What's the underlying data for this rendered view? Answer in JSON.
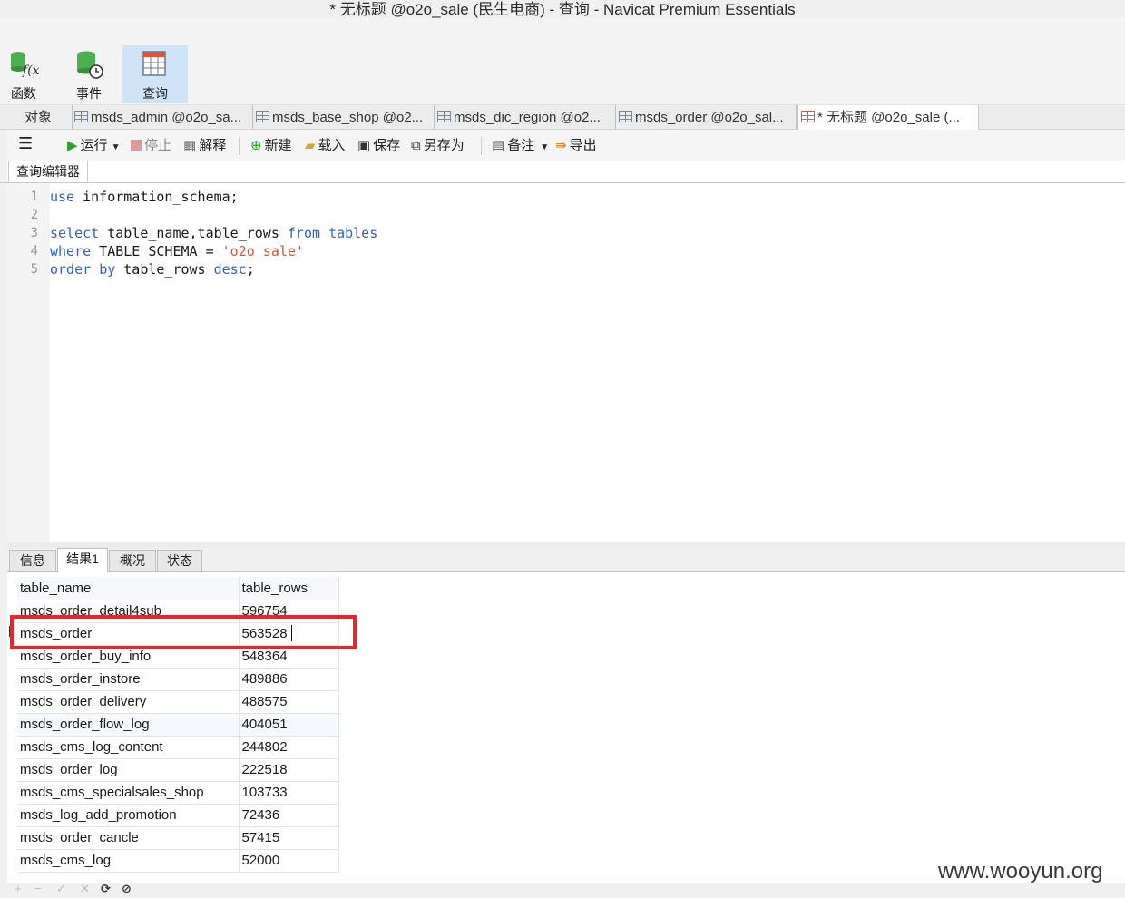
{
  "window": {
    "title": "* 无标题 @o2o_sale (民生电商) - 查询 - Navicat Premium Essentials"
  },
  "ribbon": {
    "buttons": [
      {
        "label": "函数",
        "icon": "function-icon",
        "active": false
      },
      {
        "label": "事件",
        "icon": "event-icon",
        "active": false
      },
      {
        "label": "查询",
        "icon": "query-icon",
        "active": true
      }
    ]
  },
  "tabs": [
    {
      "label": "对象"
    },
    {
      "label": "msds_admin @o2o_sa..."
    },
    {
      "label": "msds_base_shop @o2..."
    },
    {
      "label": "msds_dic_region @o2..."
    },
    {
      "label": "msds_order @o2o_sal..."
    },
    {
      "label": "* 无标题 @o2o_sale (..."
    }
  ],
  "toolbar": {
    "run": "运行",
    "stop": "停止",
    "explain": "解释",
    "new": "新建",
    "load": "载入",
    "save": "保存",
    "save_as": "另存为",
    "note": "备注",
    "export": "导出"
  },
  "editor": {
    "tab_label": "查询编辑器",
    "line_numbers": [
      "1",
      "2",
      "3",
      "4",
      "5"
    ],
    "lines": [
      [
        {
          "t": "use",
          "k": "kw"
        },
        {
          "t": " information_schema;",
          "k": ""
        }
      ],
      [],
      [
        {
          "t": "select",
          "k": "kw"
        },
        {
          "t": " table_name,table_rows ",
          "k": ""
        },
        {
          "t": "from",
          "k": "kw"
        },
        {
          "t": " ",
          "k": ""
        },
        {
          "t": "tables",
          "k": "kw"
        }
      ],
      [
        {
          "t": "where",
          "k": "kw"
        },
        {
          "t": " TABLE_SCHEMA = ",
          "k": ""
        },
        {
          "t": "'o2o_sale'",
          "k": "str"
        }
      ],
      [
        {
          "t": "order",
          "k": "kw"
        },
        {
          "t": " ",
          "k": ""
        },
        {
          "t": "by",
          "k": "kw"
        },
        {
          "t": " table_rows ",
          "k": ""
        },
        {
          "t": "desc",
          "k": "kw"
        },
        {
          "t": ";",
          "k": ""
        }
      ]
    ]
  },
  "result_tabs": [
    {
      "label": "信息",
      "active": false
    },
    {
      "label": "结果1",
      "active": true
    },
    {
      "label": "概况",
      "active": false
    },
    {
      "label": "状态",
      "active": false
    }
  ],
  "result": {
    "columns": [
      "table_name",
      "table_rows"
    ],
    "rows": [
      [
        "msds_order_detail4sub",
        "596754"
      ],
      [
        "msds_order",
        "563528"
      ],
      [
        "msds_order_buy_info",
        "548364"
      ],
      [
        "msds_order_instore",
        "489886"
      ],
      [
        "msds_order_delivery",
        "488575"
      ],
      [
        "msds_order_flow_log",
        "404051"
      ],
      [
        "msds_cms_log_content",
        "244802"
      ],
      [
        "msds_order_log",
        "222518"
      ],
      [
        "msds_cms_specialsales_shop",
        "103733"
      ],
      [
        "msds_log_add_promotion",
        "72436"
      ],
      [
        "msds_order_cancle",
        "57415"
      ],
      [
        "msds_cms_log",
        "52000"
      ]
    ],
    "highlighted_row": 1,
    "highlight_color": "#e8262d"
  },
  "bottom_bar": {
    "buttons": [
      {
        "glyph": "+",
        "name": "add-record-button",
        "enabled": false
      },
      {
        "glyph": "−",
        "name": "delete-record-button",
        "enabled": false
      },
      {
        "glyph": "✓",
        "name": "apply-button",
        "enabled": false
      },
      {
        "glyph": "✕",
        "name": "cancel-edit-button",
        "enabled": false
      },
      {
        "glyph": "⟳",
        "name": "refresh-button",
        "enabled": true
      },
      {
        "glyph": "⊘",
        "name": "stop-button",
        "enabled": true
      }
    ]
  },
  "watermark": "www.wooyun.org",
  "colors": {
    "keyword": "#2f63c8",
    "string": "#d2553a",
    "active_ribbon": "#cfe4f7"
  }
}
